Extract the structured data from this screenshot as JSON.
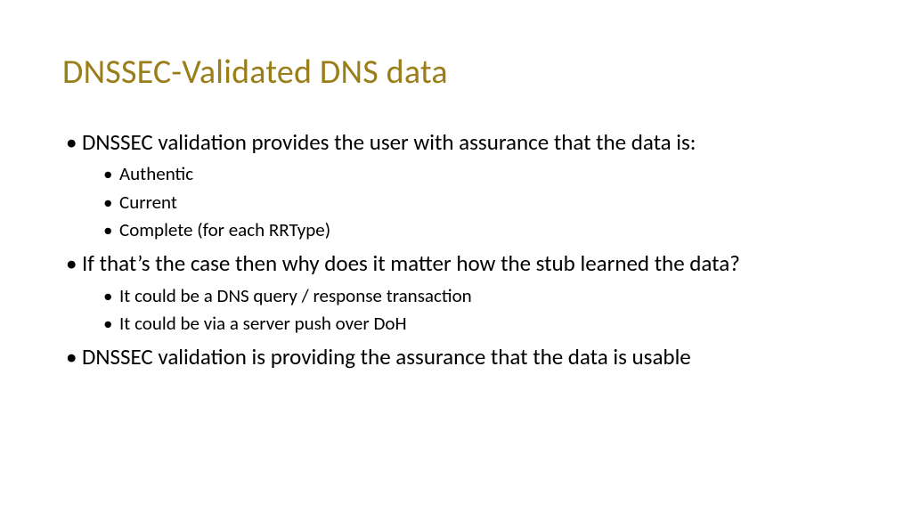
{
  "title": "DNSSEC-Validated DNS data",
  "points": [
    {
      "text": "DNSSEC validation provides the user with assurance that the data is:",
      "sub": [
        "Authentic",
        "Current",
        "Complete (for each RRType)"
      ]
    },
    {
      "text": "If that’s the case then why does it matter how the stub learned the data?",
      "sub": [
        "It could be a DNS query / response transaction",
        "It could be via a server push over DoH"
      ]
    },
    {
      "text": "DNSSEC validation is providing the assurance that the data is usable",
      "sub": []
    }
  ]
}
